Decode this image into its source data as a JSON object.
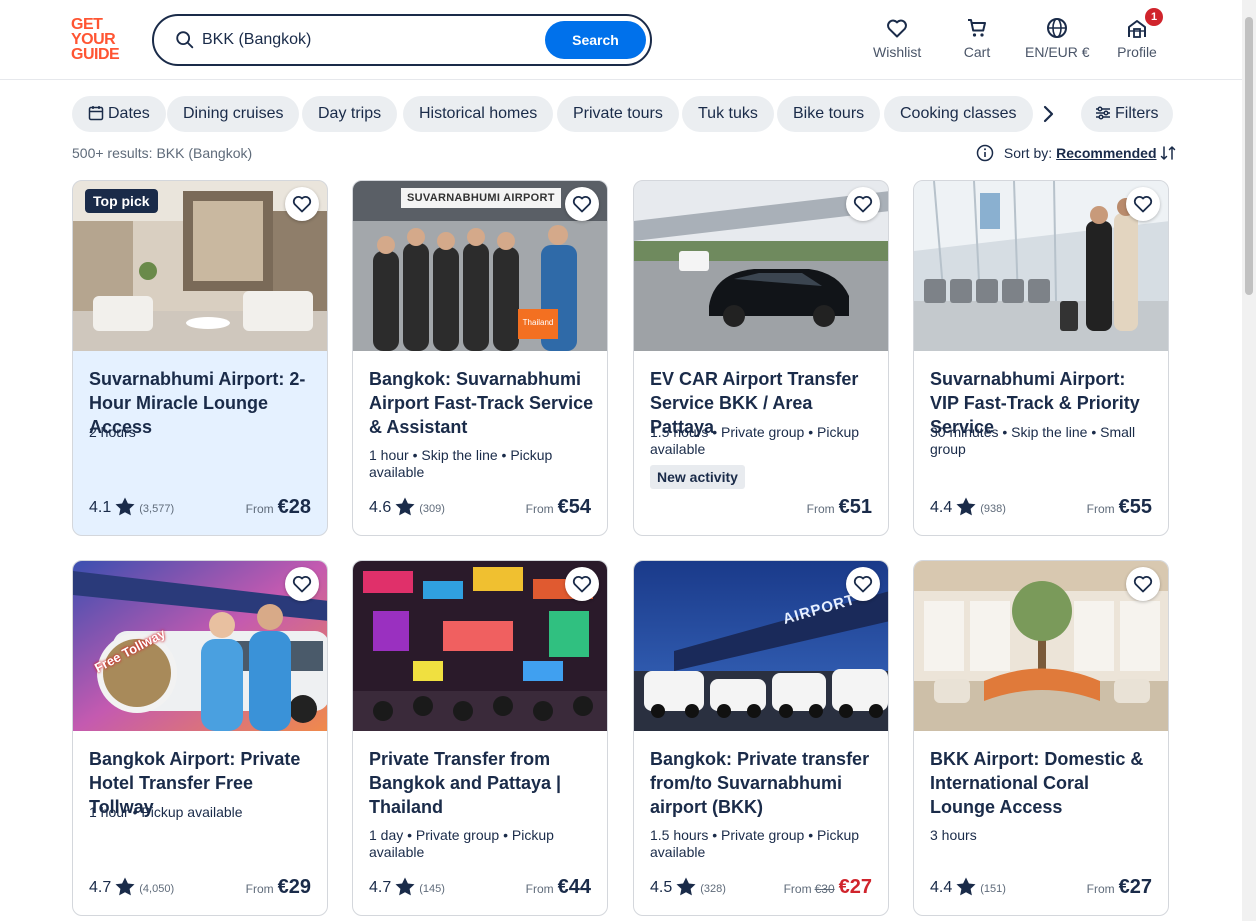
{
  "logo": {
    "line1": "GET",
    "line2": "YOUR",
    "line3": "GUIDE"
  },
  "search": {
    "value": "BKK (Bangkok)",
    "button": "Search"
  },
  "nav": {
    "wishlist": "Wishlist",
    "cart": "Cart",
    "lang": "EN/EUR €",
    "profile": "Profile",
    "profile_badge": "1"
  },
  "filters": [
    "Dates",
    "Dining cruises",
    "Day trips",
    "Historical homes",
    "Private tours",
    "Tuk tuks",
    "Bike tours",
    "Cooking classes"
  ],
  "filters_button": "Filters",
  "results_text": "500+ results: BKK (Bangkok)",
  "sort": {
    "label": "Sort by:",
    "value": "Recommended"
  },
  "cards": [
    {
      "title": "Suvarnabhumi Airport: 2-Hour Miracle Lounge Access",
      "meta": "2 hours",
      "tag": "Top pick",
      "rating": "4.1",
      "count": "(3,577)",
      "from": "From",
      "price": "€28"
    },
    {
      "title": "Bangkok: Suvarnabhumi Airport Fast-Track Service & Assistant",
      "meta": "1 hour • Skip the line • Pickup available",
      "img_sign": "SUVARNABHUMI AIRPORT",
      "img_card": "Thailand",
      "rating": "4.6",
      "count": "(309)",
      "from": "From",
      "price": "€54"
    },
    {
      "title": "EV CAR Airport Transfer Service BKK / Area Pattaya",
      "meta": "1.5 hours • Private group • Pickup available",
      "new": "New activity",
      "from": "From",
      "price": "€51"
    },
    {
      "title": "Suvarnabhumi Airport: VIP Fast-Track & Priority Service",
      "meta": "30 minutes • Skip the line • Small group",
      "rating": "4.4",
      "count": "(938)",
      "from": "From",
      "price": "€55"
    },
    {
      "title": "Bangkok Airport: Private Hotel Transfer Free Tollway",
      "meta": "1 hour • Pickup available",
      "img_text": "Free Tollway",
      "rating": "4.7",
      "count": "(4,050)",
      "from": "From",
      "price": "€29"
    },
    {
      "title": "Private Transfer from Bangkok and Pattaya | Thailand",
      "meta": "1 day • Private group • Pickup available",
      "rating": "4.7",
      "count": "(145)",
      "from": "From",
      "price": "€44"
    },
    {
      "title": "Bangkok: Private transfer from/to Suvarnabhumi airport (BKK)",
      "meta": "1.5 hours • Private group • Pickup available",
      "img_text": "AIRPORT",
      "rating": "4.5",
      "count": "(328)",
      "from": "From",
      "old_price": "€30",
      "price": "€27"
    },
    {
      "title": "BKK Airport: Domestic & International Coral Lounge Access",
      "meta": "3 hours",
      "rating": "4.4",
      "count": "(151)",
      "from": "From",
      "price": "€27"
    }
  ],
  "colors": {
    "brand": "#ff5533",
    "primary": "#0071eb",
    "navy": "#1a2b49",
    "sale": "#d0242c",
    "highlight": "#e5f1ff"
  },
  "icons": [
    "search-icon",
    "heart-icon",
    "cart-icon",
    "globe-icon",
    "profile-icon",
    "calendar-icon",
    "chevron-right-icon",
    "filters-icon",
    "info-icon",
    "sort-icon",
    "star-icon"
  ]
}
